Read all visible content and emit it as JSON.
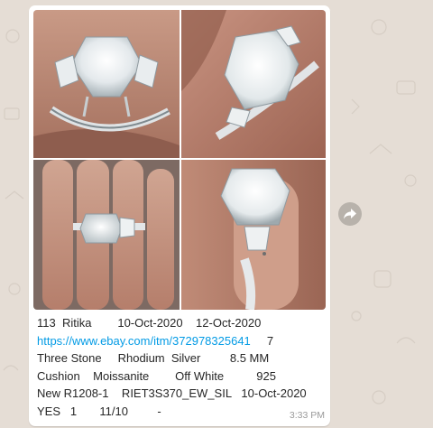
{
  "message": {
    "caption_lines": [
      "113  Ritika        10-Oct-2020    12-Oct-2020",
      "7",
      "Three Stone     Rhodium  Silver         8.5 MM",
      "Cushion    Moissanite        Off White          925",
      "New R1208-1    RIET3S370_EW_SIL   10-Oct-2020",
      "YES   1       11/10         -"
    ],
    "link": "https://www.ebay.com/itm/372978325641",
    "time": "3:33 PM"
  },
  "photos": [
    {
      "icon": "ring-photo-side-view"
    },
    {
      "icon": "ring-photo-top-view"
    },
    {
      "icon": "ring-photo-on-hand"
    },
    {
      "icon": "ring-photo-angled-view"
    }
  ],
  "actions": {
    "forward_icon": "forward-icon"
  },
  "colors": {
    "wallpaper": "#e5ddd5",
    "bubble": "#ffffff",
    "link": "#039be5",
    "timestamp": "#9a9a9a",
    "forward_button": "#b8b2ab"
  }
}
